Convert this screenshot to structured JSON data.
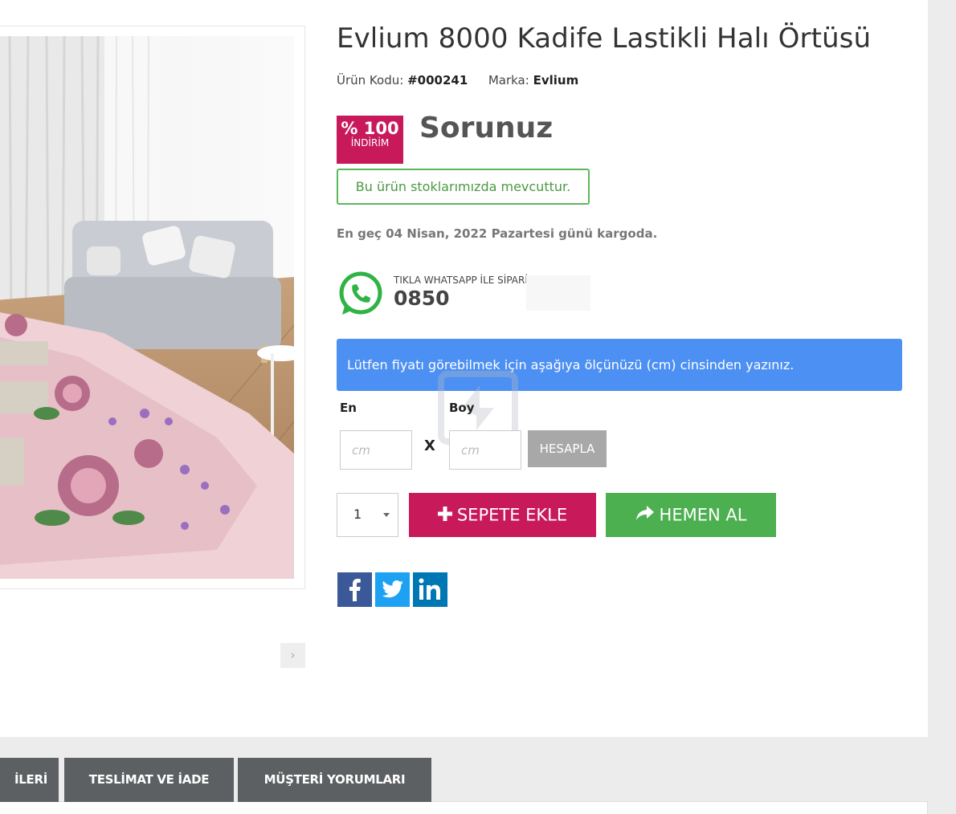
{
  "product": {
    "title": "Evlium 8000 Kadife Lastikli Halı Örtüsü",
    "code_label": "Ürün Kodu:",
    "code_value": "#000241",
    "brand_label": "Marka:",
    "brand_value": "Evlium"
  },
  "pricing": {
    "discount_percent": "% 100",
    "discount_label": "İNDİRİM",
    "price_text": "Sorunuz",
    "badge_color": "#c8195b"
  },
  "stock": {
    "message": "Bu ürün stoklarımızda mevcuttur."
  },
  "shipping": {
    "message": "En geç 04 Nisan, 2022 Pazartesi günü kargoda."
  },
  "whatsapp": {
    "icon": "whatsapp-icon",
    "label": "TIKLA WHATSAPP İLE SİPARİŞ VER",
    "phone": "0850"
  },
  "measure": {
    "info": "Lütfen fiyatı görebilmek için aşağıya ölçünüzü (cm) cinsinden yazınız.",
    "width_label": "En",
    "height_label": "Boy",
    "width_placeholder": "cm",
    "height_placeholder": "cm",
    "separator": "X",
    "calculate_label": "HESAPLA"
  },
  "purchase": {
    "quantity": "1",
    "add_to_cart_label": "SEPETE EKLE",
    "buy_now_label": "HEMEN AL",
    "cart_color": "#c8195b",
    "buy_color": "#4caf50"
  },
  "gallery": {
    "next_glyph": "›"
  },
  "share": {
    "icons": [
      "facebook-icon",
      "twitter-icon",
      "linkedin-icon"
    ]
  },
  "tabs": [
    {
      "label": "İLERİ"
    },
    {
      "label": "TESLİMAT VE İADE"
    },
    {
      "label": "MÜŞTERİ YORUMLARI"
    }
  ]
}
